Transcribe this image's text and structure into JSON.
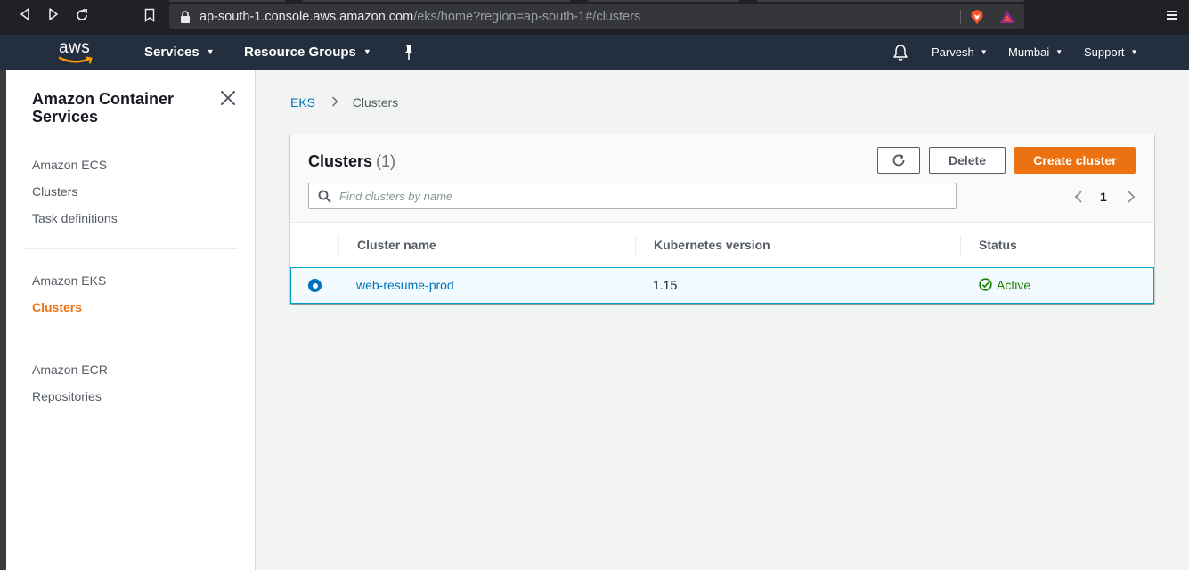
{
  "browser": {
    "url_host": "ap-south-1.console.aws.amazon.com",
    "url_path": "/eks/home?region=ap-south-1#/clusters"
  },
  "topnav": {
    "logo_text": "aws",
    "services_label": "Services",
    "resource_groups_label": "Resource Groups",
    "user_label": "Parvesh",
    "region_label": "Mumbai",
    "support_label": "Support"
  },
  "sidebar": {
    "title": "Amazon Container Services",
    "sections": [
      {
        "heading": "Amazon ECS",
        "items": [
          "Clusters",
          "Task definitions"
        ]
      },
      {
        "heading": "Amazon EKS",
        "items": [
          "Clusters"
        ]
      },
      {
        "heading": "Amazon ECR",
        "items": [
          "Repositories"
        ]
      }
    ],
    "active_item": "Clusters"
  },
  "breadcrumb": {
    "root": "EKS",
    "current": "Clusters"
  },
  "panel": {
    "title": "Clusters",
    "count": "(1)",
    "delete_label": "Delete",
    "create_label": "Create cluster",
    "search_placeholder": "Find clusters by name",
    "page_number": "1"
  },
  "table": {
    "columns": [
      "Cluster name",
      "Kubernetes version",
      "Status"
    ],
    "rows": [
      {
        "name": "web-resume-prod",
        "version": "1.15",
        "status": "Active",
        "selected": true
      }
    ]
  },
  "colors": {
    "aws_nav": "#232f3e",
    "accent_orange": "#ec7211",
    "link_blue": "#0073bb",
    "status_green": "#1d8102"
  }
}
